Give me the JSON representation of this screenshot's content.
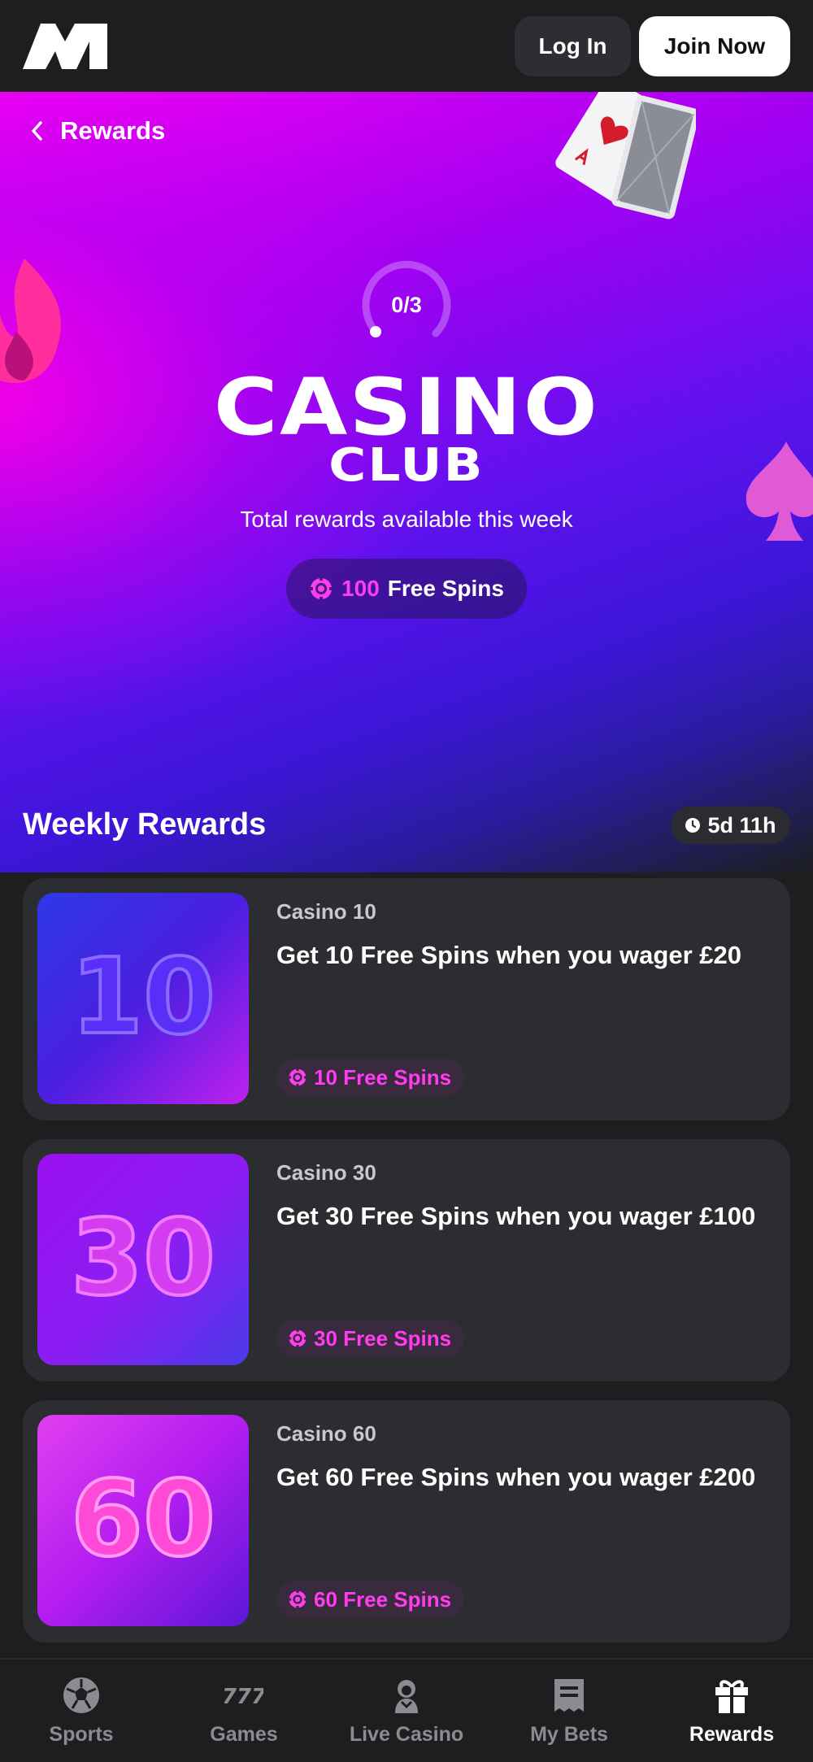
{
  "header": {
    "logo": "M",
    "login_label": "Log In",
    "join_label": "Join Now"
  },
  "hero": {
    "back_label": "Rewards",
    "progress_text": "0/3",
    "progress": {
      "completed": 0,
      "total": 3
    },
    "title_line1": "CASINO",
    "title_line2": "CLUB",
    "subtitle": "Total rewards available this week",
    "total_amount": "100",
    "total_unit": "Free Spins"
  },
  "weekly": {
    "title": "Weekly Rewards",
    "timer": "5d 11h"
  },
  "rewards": [
    {
      "category": "Casino 10",
      "description": "Get 10 Free Spins when you wager £20",
      "badge": "10 Free Spins",
      "number": "10"
    },
    {
      "category": "Casino 30",
      "description": "Get 30 Free Spins when you wager £100",
      "badge": "30 Free Spins",
      "number": "30"
    },
    {
      "category": "Casino 60",
      "description": "Get 60 Free Spins when you wager £200",
      "badge": "60 Free Spins",
      "number": "60"
    }
  ],
  "nav": {
    "items": [
      {
        "label": "Sports",
        "icon": "football-icon"
      },
      {
        "label": "Games",
        "icon": "slot-777-icon"
      },
      {
        "label": "Live Casino",
        "icon": "dealer-icon"
      },
      {
        "label": "My Bets",
        "icon": "betslip-icon"
      },
      {
        "label": "Rewards",
        "icon": "gift-icon"
      }
    ],
    "active": "Rewards"
  },
  "colors": {
    "accent_pink": "#ff3cf0",
    "background": "#1c1e20",
    "card": "#2b2d30"
  }
}
